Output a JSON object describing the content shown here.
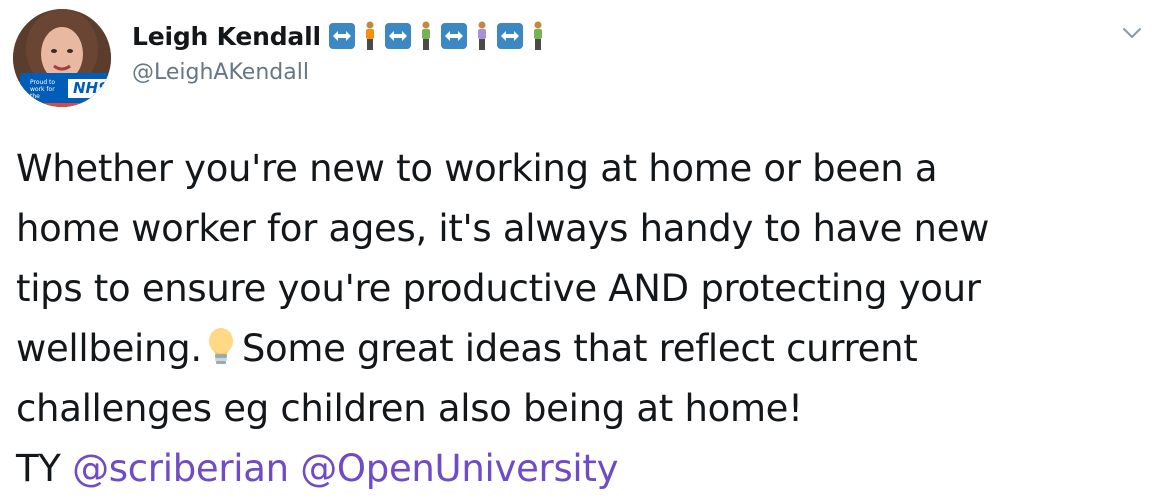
{
  "author": {
    "display_name": "Leigh Kendall",
    "handle": "@LeighAKendall",
    "avatar_badge": {
      "small_text": "Proud to work for the",
      "logo_text": "NHS"
    },
    "name_emoji": [
      {
        "kind": "left-right-arrow-icon"
      },
      {
        "kind": "person-icon",
        "shirt": "#f4900c"
      },
      {
        "kind": "left-right-arrow-icon"
      },
      {
        "kind": "person-icon",
        "shirt": "#77b255"
      },
      {
        "kind": "left-right-arrow-icon"
      },
      {
        "kind": "person-icon",
        "shirt": "#aa8ed6"
      },
      {
        "kind": "left-right-arrow-icon"
      },
      {
        "kind": "person-icon",
        "shirt": "#77b255"
      }
    ]
  },
  "tweet": {
    "line1": "Whether you're new to working at home or been a",
    "line2": "home worker for ages, it's always handy to have new",
    "line3": "tips to ensure you're productive AND protecting your",
    "line4_before": "wellbeing.",
    "line4_emoji": "light-bulb-icon",
    "line4_after": "Some great ideas that reflect current",
    "line5": "challenges eg children also being at home!",
    "line6_prefix": "TY",
    "mentions": [
      "@scriberian",
      "@OpenUniversity"
    ]
  },
  "colors": {
    "text": "#14171a",
    "secondary": "#657786",
    "mention": "#6f4bc8",
    "arrow_box": "#3b88c3",
    "nhs_blue": "#005eb8"
  },
  "menu": {
    "caret_icon": "chevron-down-icon"
  }
}
